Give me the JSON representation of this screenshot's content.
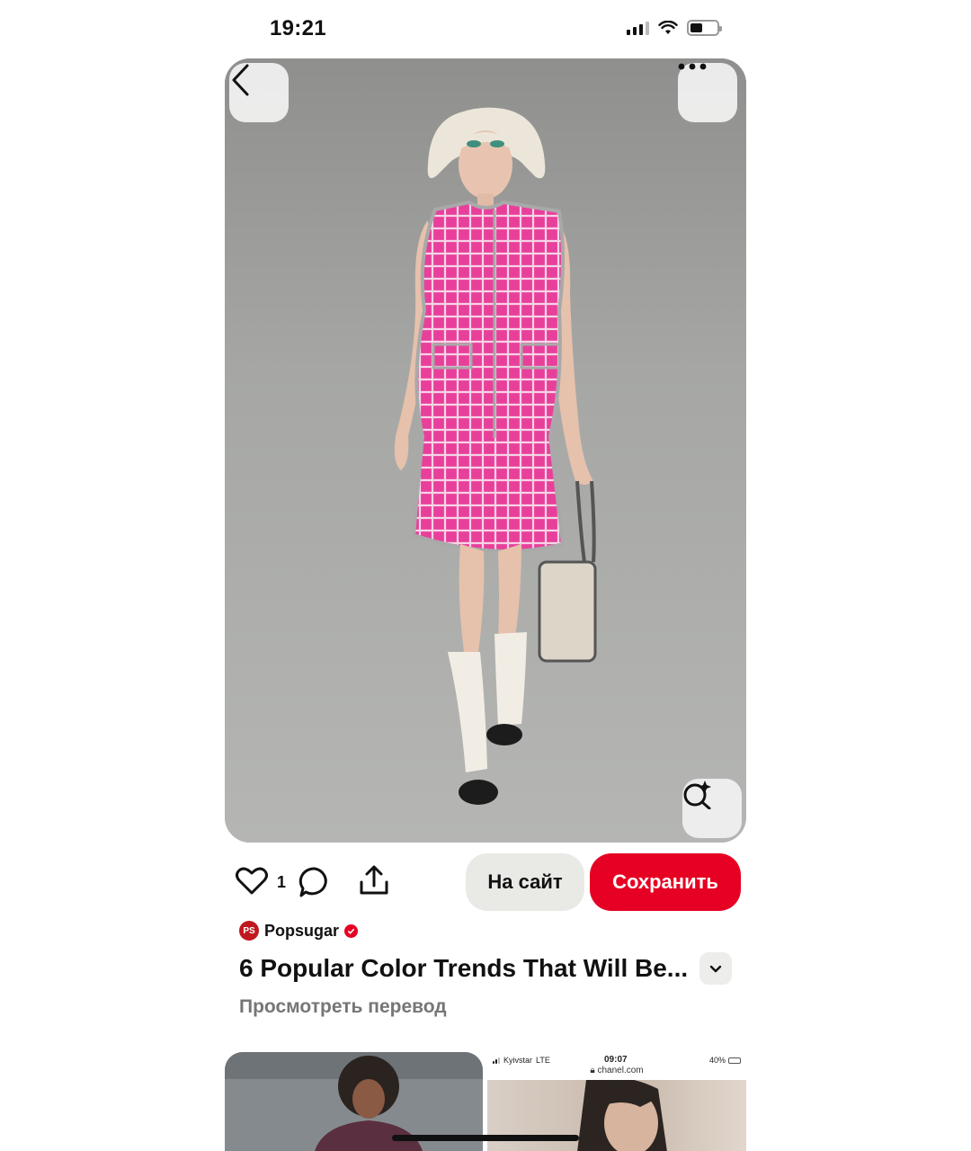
{
  "status_bar": {
    "time": "19:21",
    "icons": [
      "signal-icon",
      "wifi-icon",
      "battery-icon"
    ],
    "battery_level": 0.45
  },
  "pin": {
    "image_alt": "Runway model in pink tweed sleeveless dress",
    "back_icon": "chevron-left-icon",
    "more_icon": "ellipsis-icon",
    "lens_icon": "visual-search-icon"
  },
  "actions": {
    "like_count": "1",
    "site_label": "На сайт",
    "save_label": "Сохранить"
  },
  "source": {
    "avatar_text": "PS",
    "name": "Popsugar",
    "verified": true
  },
  "title": "6 Popular Color Trends That Will Be...",
  "translate_label": "Просмотреть перевод",
  "related": {
    "card2_status": {
      "carrier": "Kyivstar",
      "network": "LTE",
      "time": "09:07",
      "battery": "40%",
      "url": "chanel.com"
    }
  },
  "colors": {
    "accent": "#e60023",
    "text": "#111111",
    "muted": "#767676",
    "button_bg": "#e9e9e6"
  }
}
